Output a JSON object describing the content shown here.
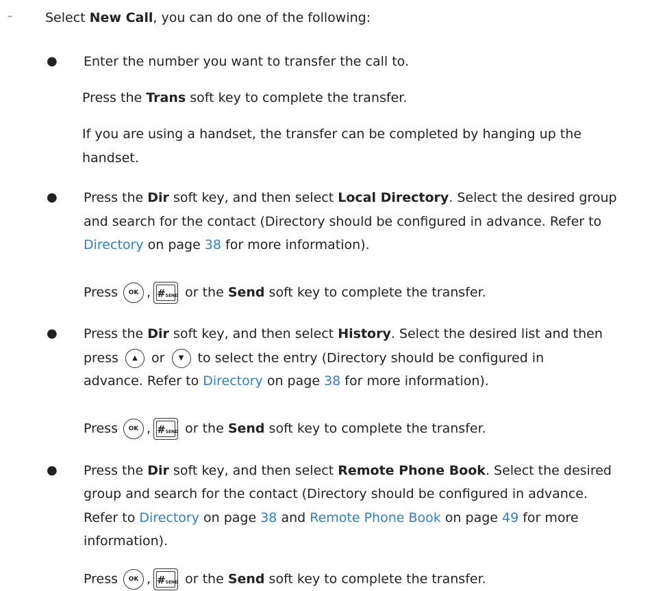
{
  "intro": {
    "pre": "Select ",
    "bold": "New Call",
    "post": ", you can do one of the following:"
  },
  "b1": {
    "l1": "Enter the number you want to transfer the call to.",
    "l2pre": "Press the ",
    "l2bold": "Trans",
    "l2post": " soft key to complete the transfer.",
    "l3": "If you are using a handset, the transfer can be completed by hanging up the",
    "l4": "handset."
  },
  "b2": {
    "l1a": "Press the ",
    "l1b": "Dir",
    "l1c": " soft key, and then select ",
    "l1d": "Local Directory",
    "l1e": ". Select the desired group",
    "l2": "and search for the contact (Directory should be configured in advance. Refer to",
    "l3link": "Directory",
    "l3mid": " on page ",
    "l3page": "38",
    "l3post": " for more information)."
  },
  "b3": {
    "l1a": "Press the ",
    "l1b": "Dir",
    "l1c": " soft key, and then select ",
    "l1d": "History",
    "l1e": ". Select the desired list and then",
    "l2a": "press ",
    "l2b": " or ",
    "l2c": " to select the entry (Directory should be configured in",
    "l3a": "advance. Refer to ",
    "l3link": "Directory",
    "l3mid": " on page ",
    "l3page": "38",
    "l3post": " for more information)."
  },
  "b4": {
    "l1a": "Press the ",
    "l1b": "Dir",
    "l1c": " soft key, and then select ",
    "l1d": "Remote Phone Book",
    "l1e": ". Select the desired",
    "l2": "group and search for the contact (Directory should be configured in advance.",
    "l3a": "Refer to ",
    "l3link1": "Directory",
    "l3mid1": " on page ",
    "l3page1": "38",
    "l3and": " and ",
    "l3link2": "Remote Phone Book",
    "l3mid2": " on page ",
    "l3page2": "49",
    "l3post": " for more",
    "l4": "information)."
  },
  "press_line": {
    "pre": "Press",
    "comma": ",",
    "or": " or the ",
    "send": "Send",
    "post": " soft key to complete the transfer."
  },
  "keys": {
    "ok": "OK",
    "hash": "#",
    "send": "SEND",
    "up": "▲",
    "down": "▼"
  }
}
